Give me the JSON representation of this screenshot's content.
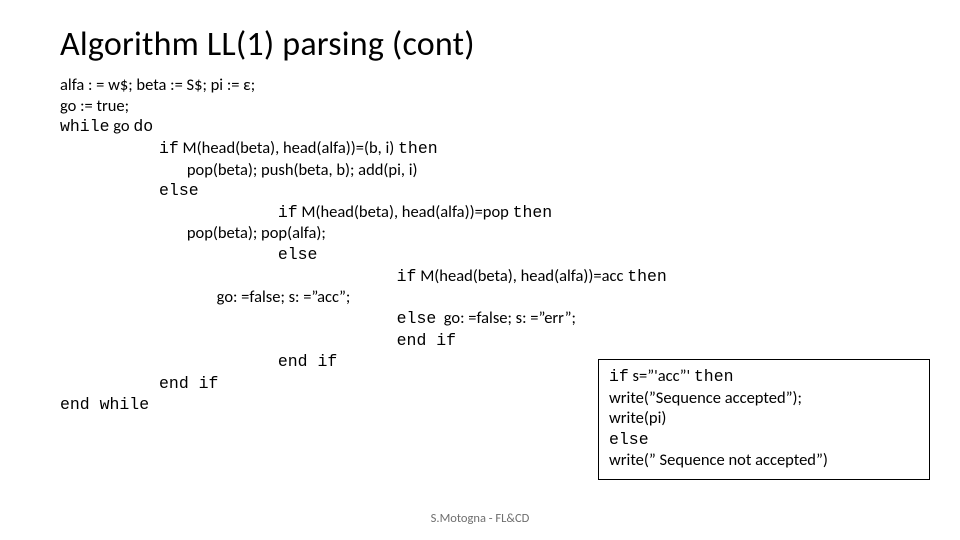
{
  "title": "Algorithm LL(1) parsing (cont)",
  "code": {
    "l1": "alfa : = w$; beta := S$; pi := ε;",
    "l2": "go := true;",
    "l3_a": "while",
    "l3_b": " go ",
    "l3_c": "do",
    "l4_a": "          if",
    "l4_b": " M(head(beta), head(alfa))=(b, i) ",
    "l4_c": "then",
    "l5": "                                  pop(beta); push(beta, b); add(pi, i)",
    "l6": "          else",
    "l7_a": "                      if",
    "l7_b": " M(head(beta), head(alfa))=pop ",
    "l7_c": "then",
    "l8": "                                  pop(beta); pop(alfa);",
    "l9": "                      else",
    "l10_a": "                                  if",
    "l10_b": " M(head(beta), head(alfa))=acc ",
    "l10_c": "then",
    "l11": "                                          go: =false; s: =”acc”;",
    "l12_a": "                                  else",
    "l12_b": "  go: =false; s: =”err”;",
    "l13": "                                  end if",
    "l14": "                      end if",
    "l15": "          end if",
    "l16": "end while"
  },
  "box": {
    "l1_a": "if",
    "l1_b": " s=”'acc”' ",
    "l1_c": "then",
    "l2": "           write(”Sequence accepted”);",
    "l3": "           write(pi)",
    "l4": "else",
    "l5": "           write(” Sequence not accepted”)"
  },
  "footer": "S.Motogna - FL&CD"
}
